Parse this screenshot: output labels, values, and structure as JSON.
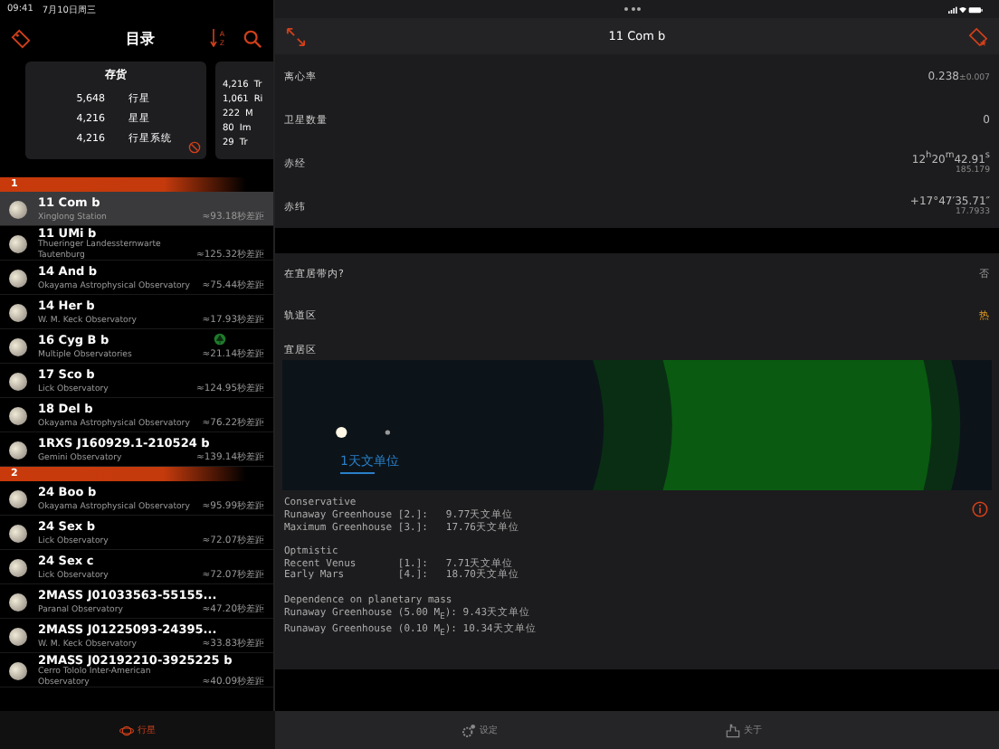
{
  "status_bar": {
    "time": "09:41",
    "date": "7月10日周三"
  },
  "sidebar": {
    "title": "目录",
    "sort_letters": [
      "A",
      "Z"
    ],
    "cards": [
      {
        "title": "存货",
        "rows": [
          {
            "count": "5,648",
            "label": "行星"
          },
          {
            "count": "4,216",
            "label": "星星"
          },
          {
            "count": "4,216",
            "label": "行星系统"
          }
        ]
      },
      {
        "rows": [
          {
            "count": "4,216",
            "label": "Tr"
          },
          {
            "count": "1,061",
            "label": "Ri"
          },
          {
            "count": "222",
            "label": "M"
          },
          {
            "count": "80",
            "label": "Im"
          },
          {
            "count": "29",
            "label": "Tr"
          }
        ]
      }
    ],
    "sections": [
      {
        "label": "1",
        "rows": [
          {
            "name": "11 Com b",
            "subtitle": "Xinglong Station",
            "distance": "≈93.18秒差距",
            "selected": true,
            "flagged": false
          },
          {
            "name": "11 UMi b",
            "subtitle": "Thueringer Landessternwarte Tautenburg",
            "distance": "≈125.32秒差距",
            "selected": false,
            "flagged": false
          },
          {
            "name": "14 And b",
            "subtitle": "Okayama Astrophysical Observatory",
            "distance": "≈75.44秒差距",
            "selected": false,
            "flagged": false
          },
          {
            "name": "14 Her b",
            "subtitle": "W. M. Keck Observatory",
            "distance": "≈17.93秒差距",
            "selected": false,
            "flagged": false
          },
          {
            "name": "16 Cyg B b",
            "subtitle": "Multiple Observatories",
            "distance": "≈21.14秒差距",
            "selected": false,
            "flagged": true
          },
          {
            "name": "17 Sco b",
            "subtitle": "Lick Observatory",
            "distance": "≈124.95秒差距",
            "selected": false,
            "flagged": false
          },
          {
            "name": "18 Del b",
            "subtitle": "Okayama Astrophysical Observatory",
            "distance": "≈76.22秒差距",
            "selected": false,
            "flagged": false
          },
          {
            "name": "1RXS J160929.1-210524 b",
            "subtitle": "Gemini Observatory",
            "distance": "≈139.14秒差距",
            "selected": false,
            "flagged": false
          }
        ]
      },
      {
        "label": "2",
        "rows": [
          {
            "name": "24 Boo b",
            "subtitle": "Okayama Astrophysical Observatory",
            "distance": "≈95.99秒差距",
            "selected": false,
            "flagged": false
          },
          {
            "name": "24 Sex b",
            "subtitle": "Lick Observatory",
            "distance": "≈72.07秒差距",
            "selected": false,
            "flagged": false
          },
          {
            "name": "24 Sex c",
            "subtitle": "Lick Observatory",
            "distance": "≈72.07秒差距",
            "selected": false,
            "flagged": false
          },
          {
            "name": "2MASS J01033563-55155...",
            "subtitle": "Paranal Observatory",
            "distance": "≈47.20秒差距",
            "selected": false,
            "flagged": false
          },
          {
            "name": "2MASS J01225093-24395...",
            "subtitle": "W. M. Keck Observatory",
            "distance": "≈33.83秒差距",
            "selected": false,
            "flagged": false
          },
          {
            "name": "2MASS J02192210-3925225 b",
            "subtitle": "Cerro Tololo Inter-American Observatory",
            "distance": "≈40.09秒差距",
            "selected": false,
            "flagged": false
          }
        ]
      }
    ]
  },
  "detail": {
    "title": "11 Com b",
    "properties": [
      {
        "label": "离心率",
        "value": "0.238",
        "uncertainty": "±0.007"
      },
      {
        "label": "卫星数量",
        "value": "0"
      },
      {
        "label": "赤经",
        "value": "12$^{h}$20$^{m}$42.91$^{s}$",
        "sub": "185.179"
      },
      {
        "label": "赤纬",
        "value": "+17°47′35.71″",
        "sub": "17.7933"
      }
    ],
    "habitability": {
      "rows": [
        {
          "label": "在宜居带内?",
          "value": "否",
          "kind": "plain"
        },
        {
          "label": "轨道区",
          "value": "热",
          "kind": "highlight"
        }
      ],
      "zone_label": "宜居区",
      "scale_label": "1天文单位",
      "notes": [
        {
          "title": "Conservative",
          "lines": [
            "Runaway Greenhouse [2.]:   9.77天文单位",
            "Maximum Greenhouse [3.]:   17.76天文单位"
          ]
        },
        {
          "title": "Optmistic",
          "lines": [
            "Recent Venus       [1.]:   7.71天文单位",
            "Early Mars         [4.]:   18.70天文单位"
          ]
        },
        {
          "title": "Dependence on planetary mass",
          "lines": [
            "Runaway Greenhouse (5.00 M$_{E}$): 9.43天文单位",
            "Runaway Greenhouse (0.10 M$_{E}$): 10.34天文单位"
          ]
        }
      ]
    }
  },
  "tab_bar": [
    {
      "label": "行星",
      "selected": true
    },
    {
      "label": "设定",
      "selected": false
    },
    {
      "label": "关于",
      "selected": false
    }
  ]
}
